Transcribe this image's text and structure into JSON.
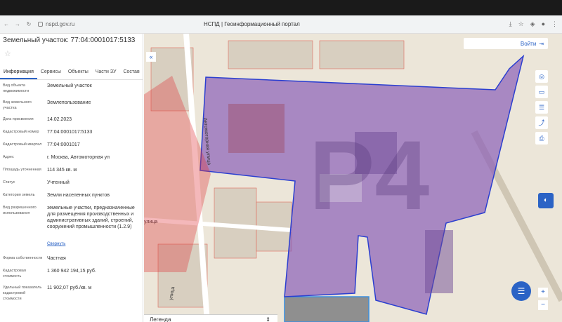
{
  "browser": {
    "url": "nspd.gov.ru",
    "page_title": "НСПД | Геоинформационный портал"
  },
  "panel": {
    "title": "Земельный участок: 77:04:0001017:5133",
    "tabs": [
      {
        "label": "Информация"
      },
      {
        "label": "Сервисы"
      },
      {
        "label": "Объекты"
      },
      {
        "label": "Части ЗУ"
      },
      {
        "label": "Состав"
      }
    ],
    "rows": [
      {
        "label": "Вид объекта недвижимости",
        "value": "Земельный участок"
      },
      {
        "label": "Вид земельного участка",
        "value": "Землепользование"
      },
      {
        "label": "Дата присвоения",
        "value": "14.02.2023"
      },
      {
        "label": "Кадастровый номер",
        "value": "77:04:0001017:5133"
      },
      {
        "label": "Кадастровый квартал",
        "value": "77:04:0001017"
      },
      {
        "label": "Адрес",
        "value": "г. Москва, Автомоторная ул"
      },
      {
        "label": "Площадь уточненная",
        "value": "114 345 кв. м"
      },
      {
        "label": "Статус",
        "value": "Учтенный"
      },
      {
        "label": "Категория земель",
        "value": "Земли населенных пунктов"
      },
      {
        "label": "Вид разрешенного использования",
        "value": "земельные участки, предназначенные для размещения производственных и административных зданий, строений, сооружений промышленности (1.2.9)"
      },
      {
        "label": "Форма собственности",
        "value": "Частная"
      },
      {
        "label": "Кадастровая стоимость",
        "value": "1 360 942 194,15 руб."
      },
      {
        "label": "Удельный показатель кадастровой стоимости",
        "value": "11 902,07 руб./кв. м"
      }
    ],
    "more_link": "Свернуть"
  },
  "map": {
    "login_label": "Войти",
    "legend_label": "Легенда",
    "street_label_1": "улица",
    "street_label_2": "улица",
    "street_label_3": "Автомоторная улица",
    "watermark": "P4",
    "accent": "#2b63c5",
    "parcel_fill": "#8b5fb8",
    "watermark_color": "#e0333a"
  }
}
